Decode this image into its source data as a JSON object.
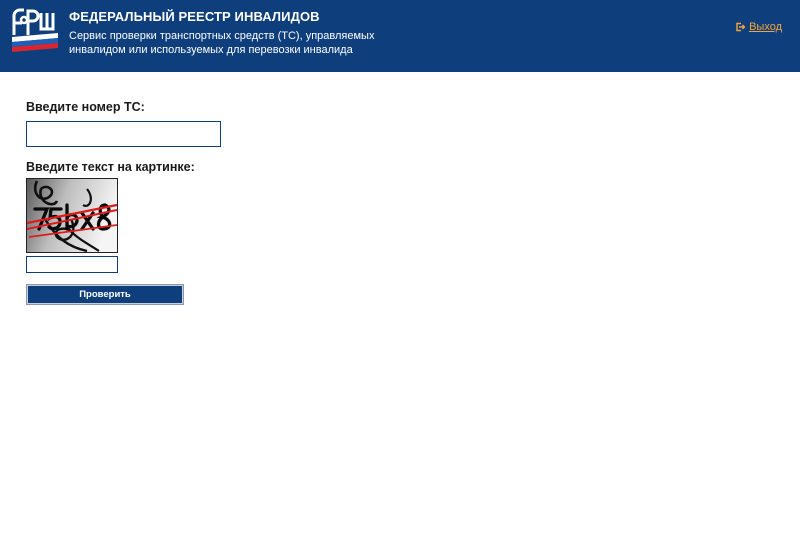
{
  "header": {
    "title": "ФЕДЕРАЛЬНЫЙ РЕЕСТР ИНВАЛИДОВ",
    "subtitle": "Сервис проверки транспортных средств (ТС), управляемых инвалидом или используемых для перевозки инвалида",
    "logout_label": "Выход",
    "logo_icon": "fri-logo-icon",
    "logout_icon": "logout-arrow-icon",
    "background_color": "#0e3f7c",
    "logout_color": "#f3a63b"
  },
  "form": {
    "vehicle_number_label": "Введите номер ТС:",
    "vehicle_number_value": "",
    "captcha_label": "Введите текст на картинке:",
    "captcha_value": "",
    "submit_label": "Проверить"
  }
}
